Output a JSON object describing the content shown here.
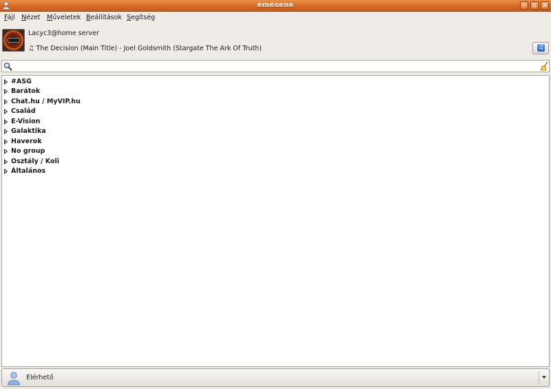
{
  "window": {
    "title": "emesene"
  },
  "menu": [
    {
      "mnemonic": "F",
      "rest": "ájl"
    },
    {
      "mnemonic": "N",
      "rest": "ézet"
    },
    {
      "mnemonic": "M",
      "rest": "űveletek"
    },
    {
      "mnemonic": "B",
      "rest": "eállítások"
    },
    {
      "mnemonic": "S",
      "rest": "egítség"
    }
  ],
  "profile": {
    "nick": "Lacyc3@home server",
    "now_playing": "♫ The Decision (Main Title) - Joel Goldsmith (Stargate The Ark Of Truth)"
  },
  "search": {
    "value": "",
    "placeholder": ""
  },
  "groups": [
    "#ASG",
    "Barátok",
    "Chat.hu / MyVIP.hu",
    "Család",
    "E-Vision",
    "Galaktika",
    "Haverok",
    "No group",
    "Osztály / Koli",
    "Általános"
  ],
  "status": {
    "selected": "Elérhető"
  },
  "icons": {
    "app": "user-icon",
    "search": "magnifier-icon",
    "clear": "broom-icon",
    "music": "music-note-icon",
    "status": "user-online-icon"
  },
  "colors": {
    "titlebar": "#d66a24",
    "window_bg": "#efebe7",
    "list_bg": "#ffffff"
  }
}
